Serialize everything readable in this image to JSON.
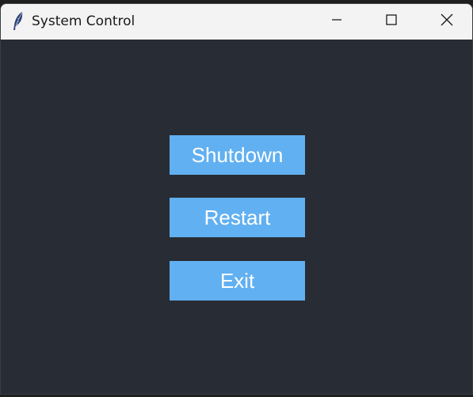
{
  "window": {
    "title": "System Control",
    "app_icon": "feather-icon",
    "controls": {
      "minimize_icon": "minimize-icon",
      "maximize_icon": "maximize-icon",
      "close_icon": "close-icon"
    }
  },
  "main": {
    "buttons": [
      {
        "label": "Shutdown"
      },
      {
        "label": "Restart"
      },
      {
        "label": "Exit"
      }
    ]
  },
  "colors": {
    "background": "#282c34",
    "button": "#61b0f1",
    "button_text": "#ffffff",
    "titlebar": "#f3f3f3"
  }
}
